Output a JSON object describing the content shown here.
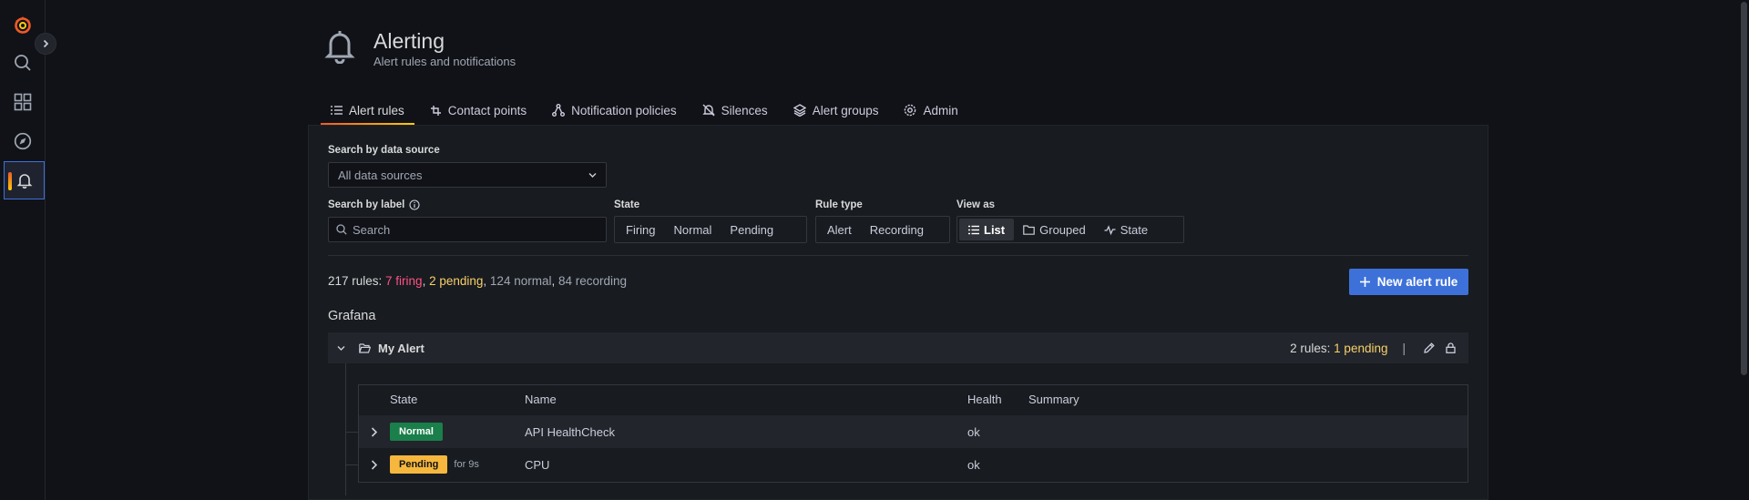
{
  "app": {
    "brand_color": "#f05a28",
    "accent": "#3d71d9"
  },
  "sidemenu": {
    "items": [
      {
        "name": "grafana-logo",
        "icon": "grafana-logo-icon"
      },
      {
        "name": "search",
        "icon": "search-icon"
      },
      {
        "name": "dashboards",
        "icon": "grid-icon"
      },
      {
        "name": "explore",
        "icon": "compass-icon"
      },
      {
        "name": "alerting",
        "icon": "bell-icon",
        "active": true
      }
    ],
    "expand_icon": "chevron-right-icon"
  },
  "header": {
    "title": "Alerting",
    "subtitle": "Alert rules and notifications",
    "icon": "bell-icon"
  },
  "tabs": [
    {
      "label": "Alert rules",
      "icon": "list-icon",
      "active": true
    },
    {
      "label": "Contact points",
      "icon": "contact-icon"
    },
    {
      "label": "Notification policies",
      "icon": "sitemap-icon"
    },
    {
      "label": "Silences",
      "icon": "bell-slash-icon"
    },
    {
      "label": "Alert groups",
      "icon": "layers-icon"
    },
    {
      "label": "Admin",
      "icon": "cog-icon"
    }
  ],
  "filters": {
    "datasource_label": "Search by data source",
    "datasource_value": "All data sources",
    "label_search_label": "Search by label",
    "label_search_placeholder": "Search",
    "state_label": "State",
    "state_options": [
      "Firing",
      "Normal",
      "Pending"
    ],
    "rule_type_label": "Rule type",
    "rule_type_options": [
      "Alert",
      "Recording"
    ],
    "view_as_label": "View as",
    "view_as_options": [
      "List",
      "Grouped",
      "State"
    ],
    "view_as_selected": "List"
  },
  "stats": {
    "prefix": "217 rules: ",
    "firing": "7 firing",
    "pending": "2 pending",
    "normal": "124 normal",
    "recording": "84 recording",
    "firing_color": "#ff5286",
    "pending_color": "#f8d06b"
  },
  "new_rule_button": "New alert rule",
  "namespace": {
    "title": "Grafana",
    "folder": {
      "name": "My Alert",
      "rules_count": "2 rules: ",
      "pending": "1 pending",
      "separator": "|"
    }
  },
  "table": {
    "headers": {
      "state": "State",
      "name": "Name",
      "health": "Health",
      "summary": "Summary"
    },
    "rows": [
      {
        "state": "Normal",
        "state_color": "#1a7f4b",
        "for": "",
        "name": "API HealthCheck",
        "health": "ok",
        "summary": ""
      },
      {
        "state": "Pending",
        "state_color": "#f5b73d",
        "for": "for 9s",
        "name": "CPU",
        "health": "ok",
        "summary": ""
      }
    ]
  }
}
